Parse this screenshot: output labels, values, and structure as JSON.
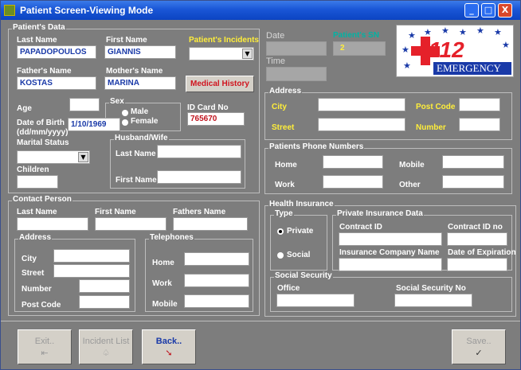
{
  "window": {
    "title": "Patient Screen-Viewing Mode",
    "controls": [
      "_",
      "□",
      "X"
    ]
  },
  "patient_data": {
    "group_label": "Patient's Data",
    "last_name_label": "Last Name",
    "last_name": "PAPADOPOULOS",
    "first_name_label": "First Name",
    "first_name": "GIANNIS",
    "incidents_label": "Patient's Incidents",
    "incidents_value": "",
    "fathers_name_label": "Father's Name",
    "fathers_name": "KOSTAS",
    "mothers_name_label": "Mother's Name",
    "mothers_name": "MARINA",
    "medical_history_button": "Medical History",
    "age_label": "Age",
    "age": "",
    "sex_label": "Sex",
    "sex_male": "Male",
    "sex_female": "Female",
    "id_card_label": "ID Card No",
    "id_card": "765670",
    "dob_label": "Date of Birth",
    "dob_format": "(dd/mm/yyyy)",
    "dob": "1/10/1969",
    "marital_label": "Marital Status",
    "marital_value": "",
    "children_label": "Children",
    "children": "",
    "spouse_group_label": "Husband/Wife",
    "spouse_last_label": "Last Name",
    "spouse_first_label": "First Name"
  },
  "header": {
    "date_label": "Date",
    "time_label": "Time",
    "patient_sn_label": "Patient's SN",
    "patient_sn": "2",
    "logo_number": "112",
    "logo_text": "EMERGENCY"
  },
  "address": {
    "group_label": "Address",
    "city_label": "City",
    "post_code_label": "Post Code",
    "street_label": "Street",
    "number_label": "Number"
  },
  "phones": {
    "group_label": "Patients Phone  Numbers",
    "home_label": "Home",
    "mobile_label": "Mobile",
    "work_label": "Work",
    "other_label": "Other"
  },
  "contact": {
    "group_label": "Contact Person",
    "last_name_label": "Last Name",
    "first_name_label": "First Name",
    "fathers_name_label": "Fathers Name",
    "address_group_label": "Address",
    "city_label": "City",
    "street_label": "Street",
    "number_label": "Number",
    "post_code_label": "Post Code",
    "tel_group_label": "Telephones",
    "home_label": "Home",
    "work_label": "Work",
    "mobile_label": "Mobile"
  },
  "insurance": {
    "group_label": "Health Insurance",
    "type_group_label": "Type",
    "private_label": "Private",
    "social_label": "Social",
    "private_group_label": "Private Insurance Data",
    "contract_id_label": "Contract ID",
    "contract_id_no_label": "Contract ID no",
    "company_label": "Insurance Company Name",
    "expiration_label": "Date of Expiration",
    "social_group_label": "Social Security",
    "office_label": "Office",
    "ssn_label": "Social Security No"
  },
  "buttons": {
    "exit": "Exit..",
    "incident_list": "Incident List",
    "back": "Back..",
    "save": "Save..",
    "exit_icon": "exit-door-icon",
    "incident_icon": "bulb-icon",
    "back_icon": "arrow-cursor-icon",
    "save_icon": "checkmark-icon"
  },
  "colors": {
    "panel": "#7d7d7d",
    "title_bar": "#1a56d6",
    "label_yellow": "#ffee3a",
    "value_blue": "#1a3aa8",
    "value_red": "#c0141e",
    "sn_teal": "#00b3a4"
  }
}
